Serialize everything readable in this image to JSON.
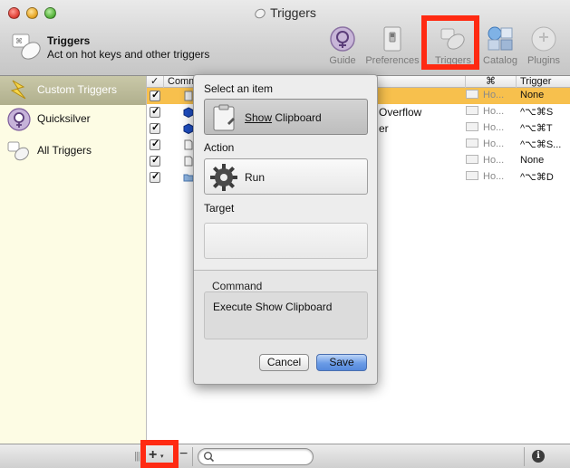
{
  "window": {
    "title": "Triggers"
  },
  "header": {
    "title": "Triggers",
    "subtitle": "Act on hot keys and other triggers"
  },
  "toolbar": {
    "items": [
      {
        "label": "Guide",
        "icon": "guide-icon"
      },
      {
        "label": "Preferences",
        "icon": "preferences-switch-icon"
      },
      {
        "label": "Triggers",
        "icon": "triggers-icon"
      },
      {
        "label": "Catalog",
        "icon": "catalog-icon"
      },
      {
        "label": "Plugins",
        "icon": "plugins-icon"
      }
    ],
    "highlight_color": "#ff2a12"
  },
  "sidebar": {
    "items": [
      {
        "label": "Custom Triggers",
        "icon": "lightning-icon",
        "selected": true
      },
      {
        "label": "Quicksilver",
        "icon": "quicksilver-icon",
        "selected": false
      },
      {
        "label": "All Triggers",
        "icon": "mouse-icon",
        "selected": false
      }
    ]
  },
  "table": {
    "columns": {
      "check": "✓",
      "command": "Comm",
      "scope": "⌘",
      "trigger": "Trigger"
    },
    "rows": [
      {
        "command": "",
        "scope": "Ho...",
        "trigger": "None",
        "selected": true,
        "icon": "clipboard-icon"
      },
      {
        "command": "Overflow",
        "scope": "Ho...",
        "trigger": "^⌥⌘S",
        "selected": false,
        "icon": "cube-icon"
      },
      {
        "command": "er",
        "scope": "Ho...",
        "trigger": "^⌥⌘T",
        "selected": false,
        "icon": "cube-icon"
      },
      {
        "command": "",
        "scope": "Ho...",
        "trigger": "^⌥⌘S...",
        "selected": false,
        "icon": "document-icon"
      },
      {
        "command": "",
        "scope": "Ho...",
        "trigger": "None",
        "selected": false,
        "icon": "document-icon"
      },
      {
        "command": "",
        "scope": "Ho...",
        "trigger": "^⌥⌘D",
        "selected": false,
        "icon": "folder-icon"
      }
    ]
  },
  "popover": {
    "select_label": "Select an item",
    "item_underlined": "Show",
    "item_rest": " Clipboard",
    "action_label": "Action",
    "action_value": "Run",
    "target_label": "Target",
    "target_value": "",
    "command_label": "Command",
    "command_value": "Execute Show Clipboard",
    "cancel_label": "Cancel",
    "save_label": "Save"
  },
  "bottombar": {
    "grip": "|||",
    "add_label": "+",
    "add_caret": "▾",
    "remove_label": "−",
    "search_placeholder": "",
    "info_label": "i"
  }
}
